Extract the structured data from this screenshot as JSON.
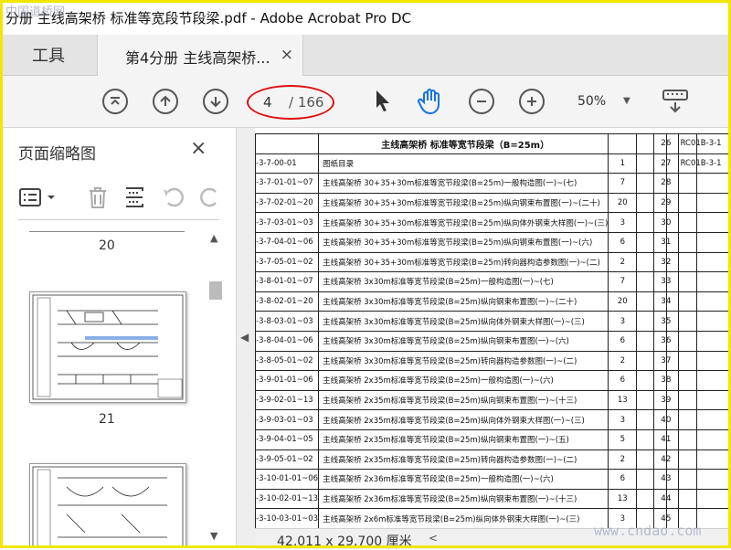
{
  "window": {
    "title": "分册 主线高架桥 标准等宽段节段梁.pdf - Adobe Acrobat Pro DC"
  },
  "watermark_top": "中国道桥网",
  "watermark_bottom": "www.cndao.com",
  "tabs": {
    "tools": "工具",
    "doc": "第4分册 主线高架桥...",
    "close": "×"
  },
  "toolbar": {
    "page_current": "4",
    "page_total": "/ 166",
    "zoom": "50%"
  },
  "sidebar": {
    "title": "页面缩略图",
    "close": "×",
    "pages": [
      "20",
      "21"
    ]
  },
  "doc": {
    "header_title": "主线高架桥 标准等宽节段梁（B=25m）",
    "rows": [
      {
        "code": "-3-7-00-01",
        "name": "图纸目录",
        "n": "1"
      },
      {
        "code": "-3-7-01-01~07",
        "name": "主线高架桥 30+35+30m标准等宽节段梁(B=25m)一般构造图(一)~(七)",
        "n": "7"
      },
      {
        "code": "-3-7-02-01~20",
        "name": "主线高架桥 30+35+30m标准等宽节段梁(B=25m)纵向钢束布置图(一)~(二十)",
        "n": "20"
      },
      {
        "code": "-3-7-03-01~03",
        "name": "主线高架桥 30+35+30m标准等宽节段梁(B=25m)纵向体外钢束大样图(一)~(三)",
        "n": "3"
      },
      {
        "code": "-3-7-04-01~06",
        "name": "主线高架桥 30+35+30m标准等宽节段梁(B=25m)纵向钢束布置图(一)~(六)",
        "n": "6"
      },
      {
        "code": "-3-7-05-01~02",
        "name": "主线高架桥 30+35+30m标准等宽节段梁(B=25m)转向器构造参数图(一)~(二)",
        "n": "2"
      },
      {
        "code": "-3-8-01-01~07",
        "name": "主线高架桥 3x30m标准等宽节段梁(B=25m)一般构造图(一)~(七)",
        "n": "7"
      },
      {
        "code": "-3-8-02-01~20",
        "name": "主线高架桥 3x30m标准等宽节段梁(B=25m)纵向钢束布置图(一)~(二十)",
        "n": "20"
      },
      {
        "code": "-3-8-03-01~03",
        "name": "主线高架桥 3x30m标准等宽节段梁(B=25m)纵向体外钢束大样图(一)~(三)",
        "n": "3"
      },
      {
        "code": "-3-8-04-01~06",
        "name": "主线高架桥 3x30m标准等宽节段梁(B=25m)纵向钢束布置图(一)~(六)",
        "n": "6"
      },
      {
        "code": "-3-8-05-01~02",
        "name": "主线高架桥 3x30m标准等宽节段梁(B=25m)转向器构造参数图(一)~(二)",
        "n": "2"
      },
      {
        "code": "-3-9-01-01~06",
        "name": "主线高架桥 2x35m标准等宽节段梁(B=25m)一般构造图(一)~(六)",
        "n": "6"
      },
      {
        "code": "-3-9-02-01~13",
        "name": "主线高架桥 2x35m标准等宽节段梁(B=25m)纵向钢束布置图(一)~(十三)",
        "n": "13"
      },
      {
        "code": "-3-9-03-01~03",
        "name": "主线高架桥 2x35m标准等宽节段梁(B=25m)纵向体外钢束大样图(一)~(三)",
        "n": "3"
      },
      {
        "code": "-3-9-04-01~05",
        "name": "主线高架桥 2x35m标准等宽节段梁(B=25m)纵向钢束布置图(一)~(五)",
        "n": "5"
      },
      {
        "code": "-3-9-05-01~02",
        "name": "主线高架桥 2x35m标准等宽节段梁(B=25m)转向器构造参数图(一)~(二)",
        "n": "2"
      },
      {
        "code": "-3-10-01-01~06",
        "name": "主线高架桥 2x36m标准等宽节段梁(B=25m)一般构造图(一)~(六)",
        "n": "6"
      },
      {
        "code": "-3-10-02-01~13",
        "name": "主线高架桥 2x36m标准等宽节段梁(B=25m)纵向钢束布置图(一)~(十三)",
        "n": "13"
      },
      {
        "code": "-3-10-03-01~03",
        "name": "主线高架桥 2x6m标准等宽节段梁(B=25m)纵向体外钢束大样图(一)~(三)",
        "n": "3"
      }
    ],
    "right_rows": [
      {
        "no": "26",
        "code": "RC01B-3-1"
      },
      {
        "no": "27",
        "code": "RC01B-3-1"
      },
      {
        "no": "28",
        "code": ""
      },
      {
        "no": "29",
        "code": ""
      },
      {
        "no": "30",
        "code": ""
      },
      {
        "no": "31",
        "code": ""
      },
      {
        "no": "32",
        "code": ""
      },
      {
        "no": "33",
        "code": ""
      },
      {
        "no": "34",
        "code": ""
      },
      {
        "no": "35",
        "code": ""
      },
      {
        "no": "36",
        "code": ""
      },
      {
        "no": "37",
        "code": ""
      },
      {
        "no": "38",
        "code": ""
      },
      {
        "no": "39",
        "code": ""
      },
      {
        "no": "40",
        "code": ""
      },
      {
        "no": "41",
        "code": ""
      },
      {
        "no": "42",
        "code": ""
      },
      {
        "no": "43",
        "code": ""
      },
      {
        "no": "44",
        "code": ""
      },
      {
        "no": "45",
        "code": ""
      }
    ]
  },
  "status": {
    "dimensions": "42.011 x 29.700 厘米"
  }
}
